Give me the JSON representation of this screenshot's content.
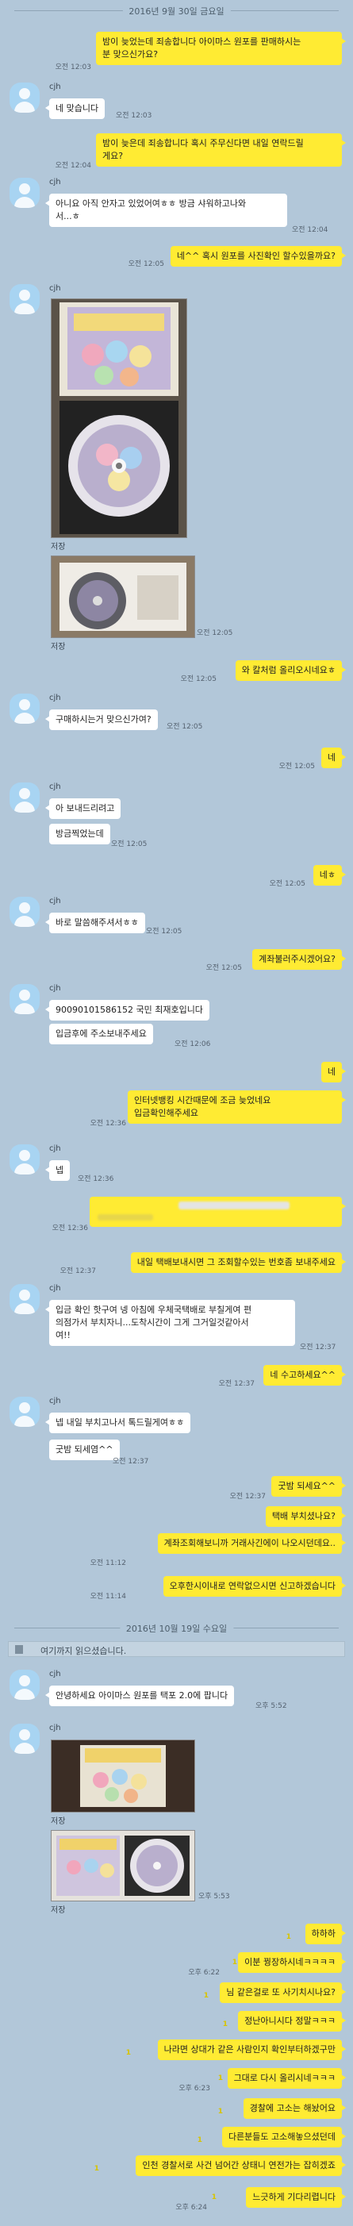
{
  "dates": [
    "2016년 9월 30일 금요일",
    "2016년 10월 19일 수요일"
  ],
  "sender_name": "cjh",
  "photo_label": "저장",
  "notice": "여기까지 읽으셨습니다.",
  "read_mark": "1",
  "messages": [
    {
      "text": "밤이 늦었는데 죄송합니다 아이마스 원포를 판매하시는 \n분 맞으신가요?",
      "time": "오전 12:03"
    },
    {
      "text": "네 맞습니다",
      "time": "오전 12:03"
    },
    {
      "text": "밤이 늦은데 죄송합니다 혹시 주무신다면 내일 연락드릴\n게요?",
      "time": "오전 12:04"
    },
    {
      "text": "아니요 아직 안자고 있었어여ㅎㅎ 방금 샤워하고나와\n서...ㅎ",
      "time": "오전 12:04"
    },
    {
      "text": "네^^ 혹시 원포를 사진확인 할수있을까요?",
      "time": "오전 12:05"
    },
    {
      "text": "",
      "time": "오전 12:05"
    },
    {
      "text": "와 칼처럼 올리오시네요ㅎ",
      "time": "오전 12:05"
    },
    {
      "text": "구매하시는거 맞으신가여?",
      "time": "오전 12:05"
    },
    {
      "text": "네",
      "time": "오전 12:05"
    },
    {
      "text": "아 보내드리려고",
      "time": ""
    },
    {
      "text": "방금찍었는데",
      "time": "오전 12:05"
    },
    {
      "text": "네ㅎ",
      "time": "오전 12:05"
    },
    {
      "text": "바로 말씀해주셔서ㅎㅎ",
      "time": "오전 12:05"
    },
    {
      "text": "계좌불러주시겠어요?",
      "time": "오전 12:05"
    },
    {
      "text": "90090101586152 국민 최재호입니다",
      "time": ""
    },
    {
      "text": "입금후에 주소보내주세요",
      "time": "오전 12:06"
    },
    {
      "text": "네",
      "time": ""
    },
    {
      "text": "인터넷뱅킹 시간때문에 조금 늦었네요\n입금확인해주세요",
      "time": "오전 12:36"
    },
    {
      "text": "넵",
      "time": "오전 12:36"
    },
    {
      "text": "",
      "time": "오전 12:36"
    },
    {
      "text": "내일 택배보내시면 그 조회할수있는 번호좀 보내주세요",
      "time": "오전 12:37"
    },
    {
      "text": "입금 확인 핫구여 넹 아침에 우체국택배로 부칠게여 편\n의점가서 부치자니...도착시간이 그게 그거일것같아서\n여!!",
      "time": "오전 12:37"
    },
    {
      "text": "네 수고하세요^^",
      "time": "오전 12:37"
    },
    {
      "text": "넵 내일 부치고나서 톡드릴게여ㅎㅎ",
      "time": ""
    },
    {
      "text": "굿밤 되세염^^",
      "time": "오전 12:37"
    },
    {
      "text": "굿밤 되세요^^",
      "time": "오전 12:37"
    },
    {
      "text": "택배 부치셨나요?",
      "time": ""
    },
    {
      "text": "계좌조회해보니까 거래사긴에이 나오시던데요..",
      "time": "오전 11:12"
    },
    {
      "text": "오후한시이내로 연락없으시면 신고하겠습니다",
      "time": "오전 11:14"
    },
    {
      "text": "안녕하세요 아이마스 원포를 택포 2.0에 팝니다",
      "time": "오후 5:52"
    },
    {
      "text": "",
      "time": "오후 5:53"
    },
    {
      "text": "하하하",
      "time": ""
    },
    {
      "text": "이분 꿩장하시네ㅋㅋㅋㅋ",
      "time": "오후 6:22"
    },
    {
      "text": "님 같은걸로 또 사기치시나요?",
      "time": ""
    },
    {
      "text": "정난아니시다 정말ㅋㅋㅋ",
      "time": ""
    },
    {
      "text": "나라면 상대가 같은 사람인지 확인부터하겠구만",
      "time": ""
    },
    {
      "text": "그대로 다시 올리시네ㅋㅋㅋ",
      "time": "오후 6:23"
    },
    {
      "text": "경찰에 고소는 해놨어요",
      "time": ""
    },
    {
      "text": "다른분들도 고소해놓으셨던데",
      "time": ""
    },
    {
      "text": "인천 경찰서로 사건 넘어간 상태니 연전가는 잡히겠죠",
      "time": ""
    },
    {
      "text": "느긋하게 기다리렵니다",
      "time": "오후 6:24"
    }
  ]
}
